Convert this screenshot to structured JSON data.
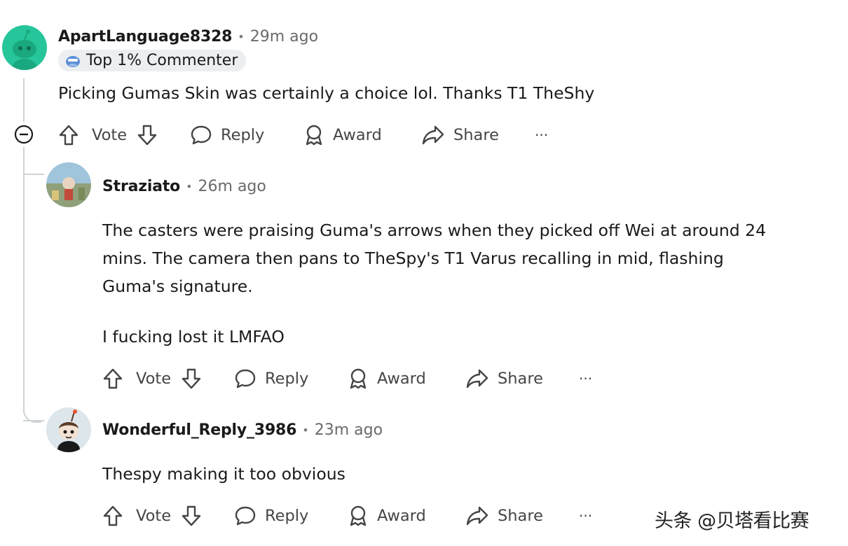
{
  "comments": [
    {
      "username": "ApartLanguage8328",
      "time": "29m ago",
      "flair": "Top 1% Commenter",
      "body": [
        "Picking Gumas Skin was certainly a choice lol. Thanks T1 TheShy"
      ]
    },
    {
      "username": "Straziato",
      "time": "26m ago",
      "body": [
        "The casters were praising Guma's arrows when they picked off Wei at around 24",
        "mins. The camera then pans to TheSpy's T1 Varus recalling in mid, flashing",
        "Guma's signature.",
        "I fucking lost it LMFAO"
      ]
    },
    {
      "username": "Wonderful_Reply_3986",
      "time": "23m ago",
      "body": [
        "Thespy making it too obvious"
      ]
    }
  ],
  "actions": {
    "vote": "Vote",
    "reply": "Reply",
    "award": "Award",
    "share": "Share",
    "more": "···"
  },
  "separator": "•",
  "watermark": "头条 @贝塔看比赛",
  "colors": {
    "thread_line": "#cfd3d6",
    "avatar_green": "#26c69a",
    "text": "#1a1a1b",
    "muted": "#6a6a6a"
  }
}
